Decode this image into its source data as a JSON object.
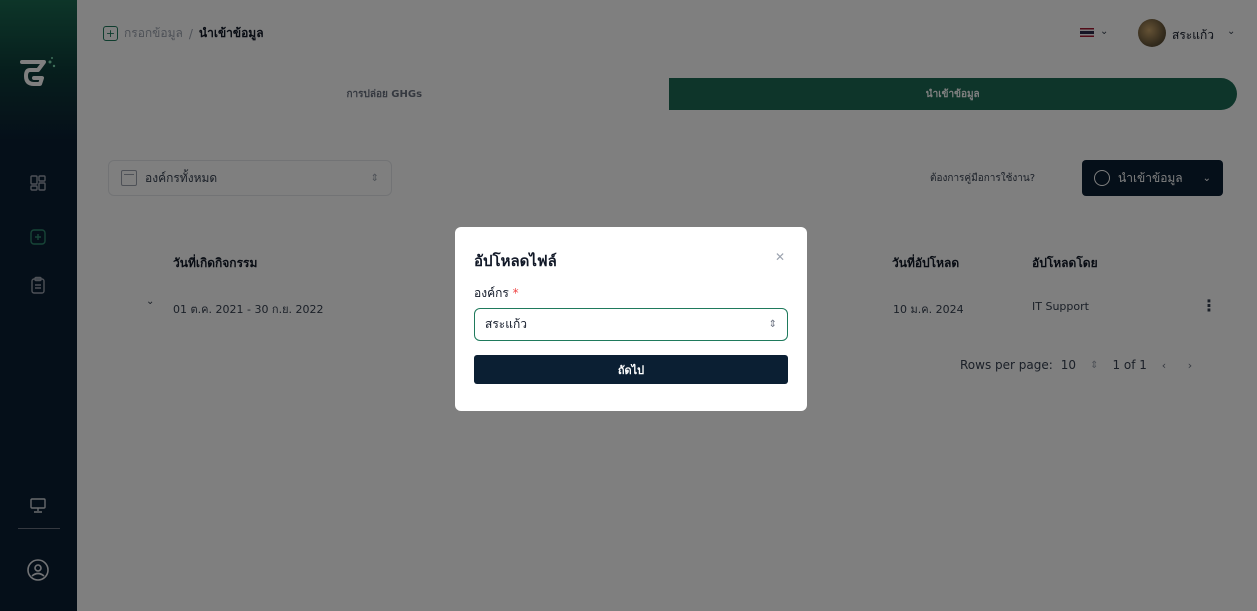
{
  "breadcrumb": {
    "parent": "กรอกข้อมูล",
    "separator": "/",
    "current": "นำเข้าข้อมูล"
  },
  "header": {
    "user_name": "สระแก้ว",
    "flag_icon": "thai-flag-icon"
  },
  "tabs": [
    {
      "label": "การปล่อย GHGs",
      "active": false
    },
    {
      "label": "นำเข้าข้อมูล",
      "active": true
    }
  ],
  "toolbar": {
    "org_select_value": "องค์กรทั้งหมด",
    "help_text": "ต้องการคู่มือการใช้งาน?",
    "import_label": "นำเข้าข้อมูล"
  },
  "table": {
    "headers": [
      "วันที่เกิดกิจกรรม",
      "วันที่อัปโหลด",
      "อัปโหลดโดย"
    ],
    "rows": [
      {
        "period": "01 ต.ค. 2021 - 30 ก.ย. 2022",
        "upload_date": "10 ม.ค. 2024",
        "uploaded_by": "IT Support"
      }
    ]
  },
  "pagination": {
    "rows_label": "Rows per page:",
    "rows_value": "10",
    "range": "1 of 1"
  },
  "modal": {
    "title": "อัปโหลดไฟล์",
    "field_label": "องค์กร",
    "required_mark": "*",
    "select_value": "สระแก้ว",
    "next_label": "ถัดไป"
  },
  "colors": {
    "primary_dark": "#0b1f33",
    "accent_green": "#1c6b55",
    "required": "#ef4444"
  }
}
